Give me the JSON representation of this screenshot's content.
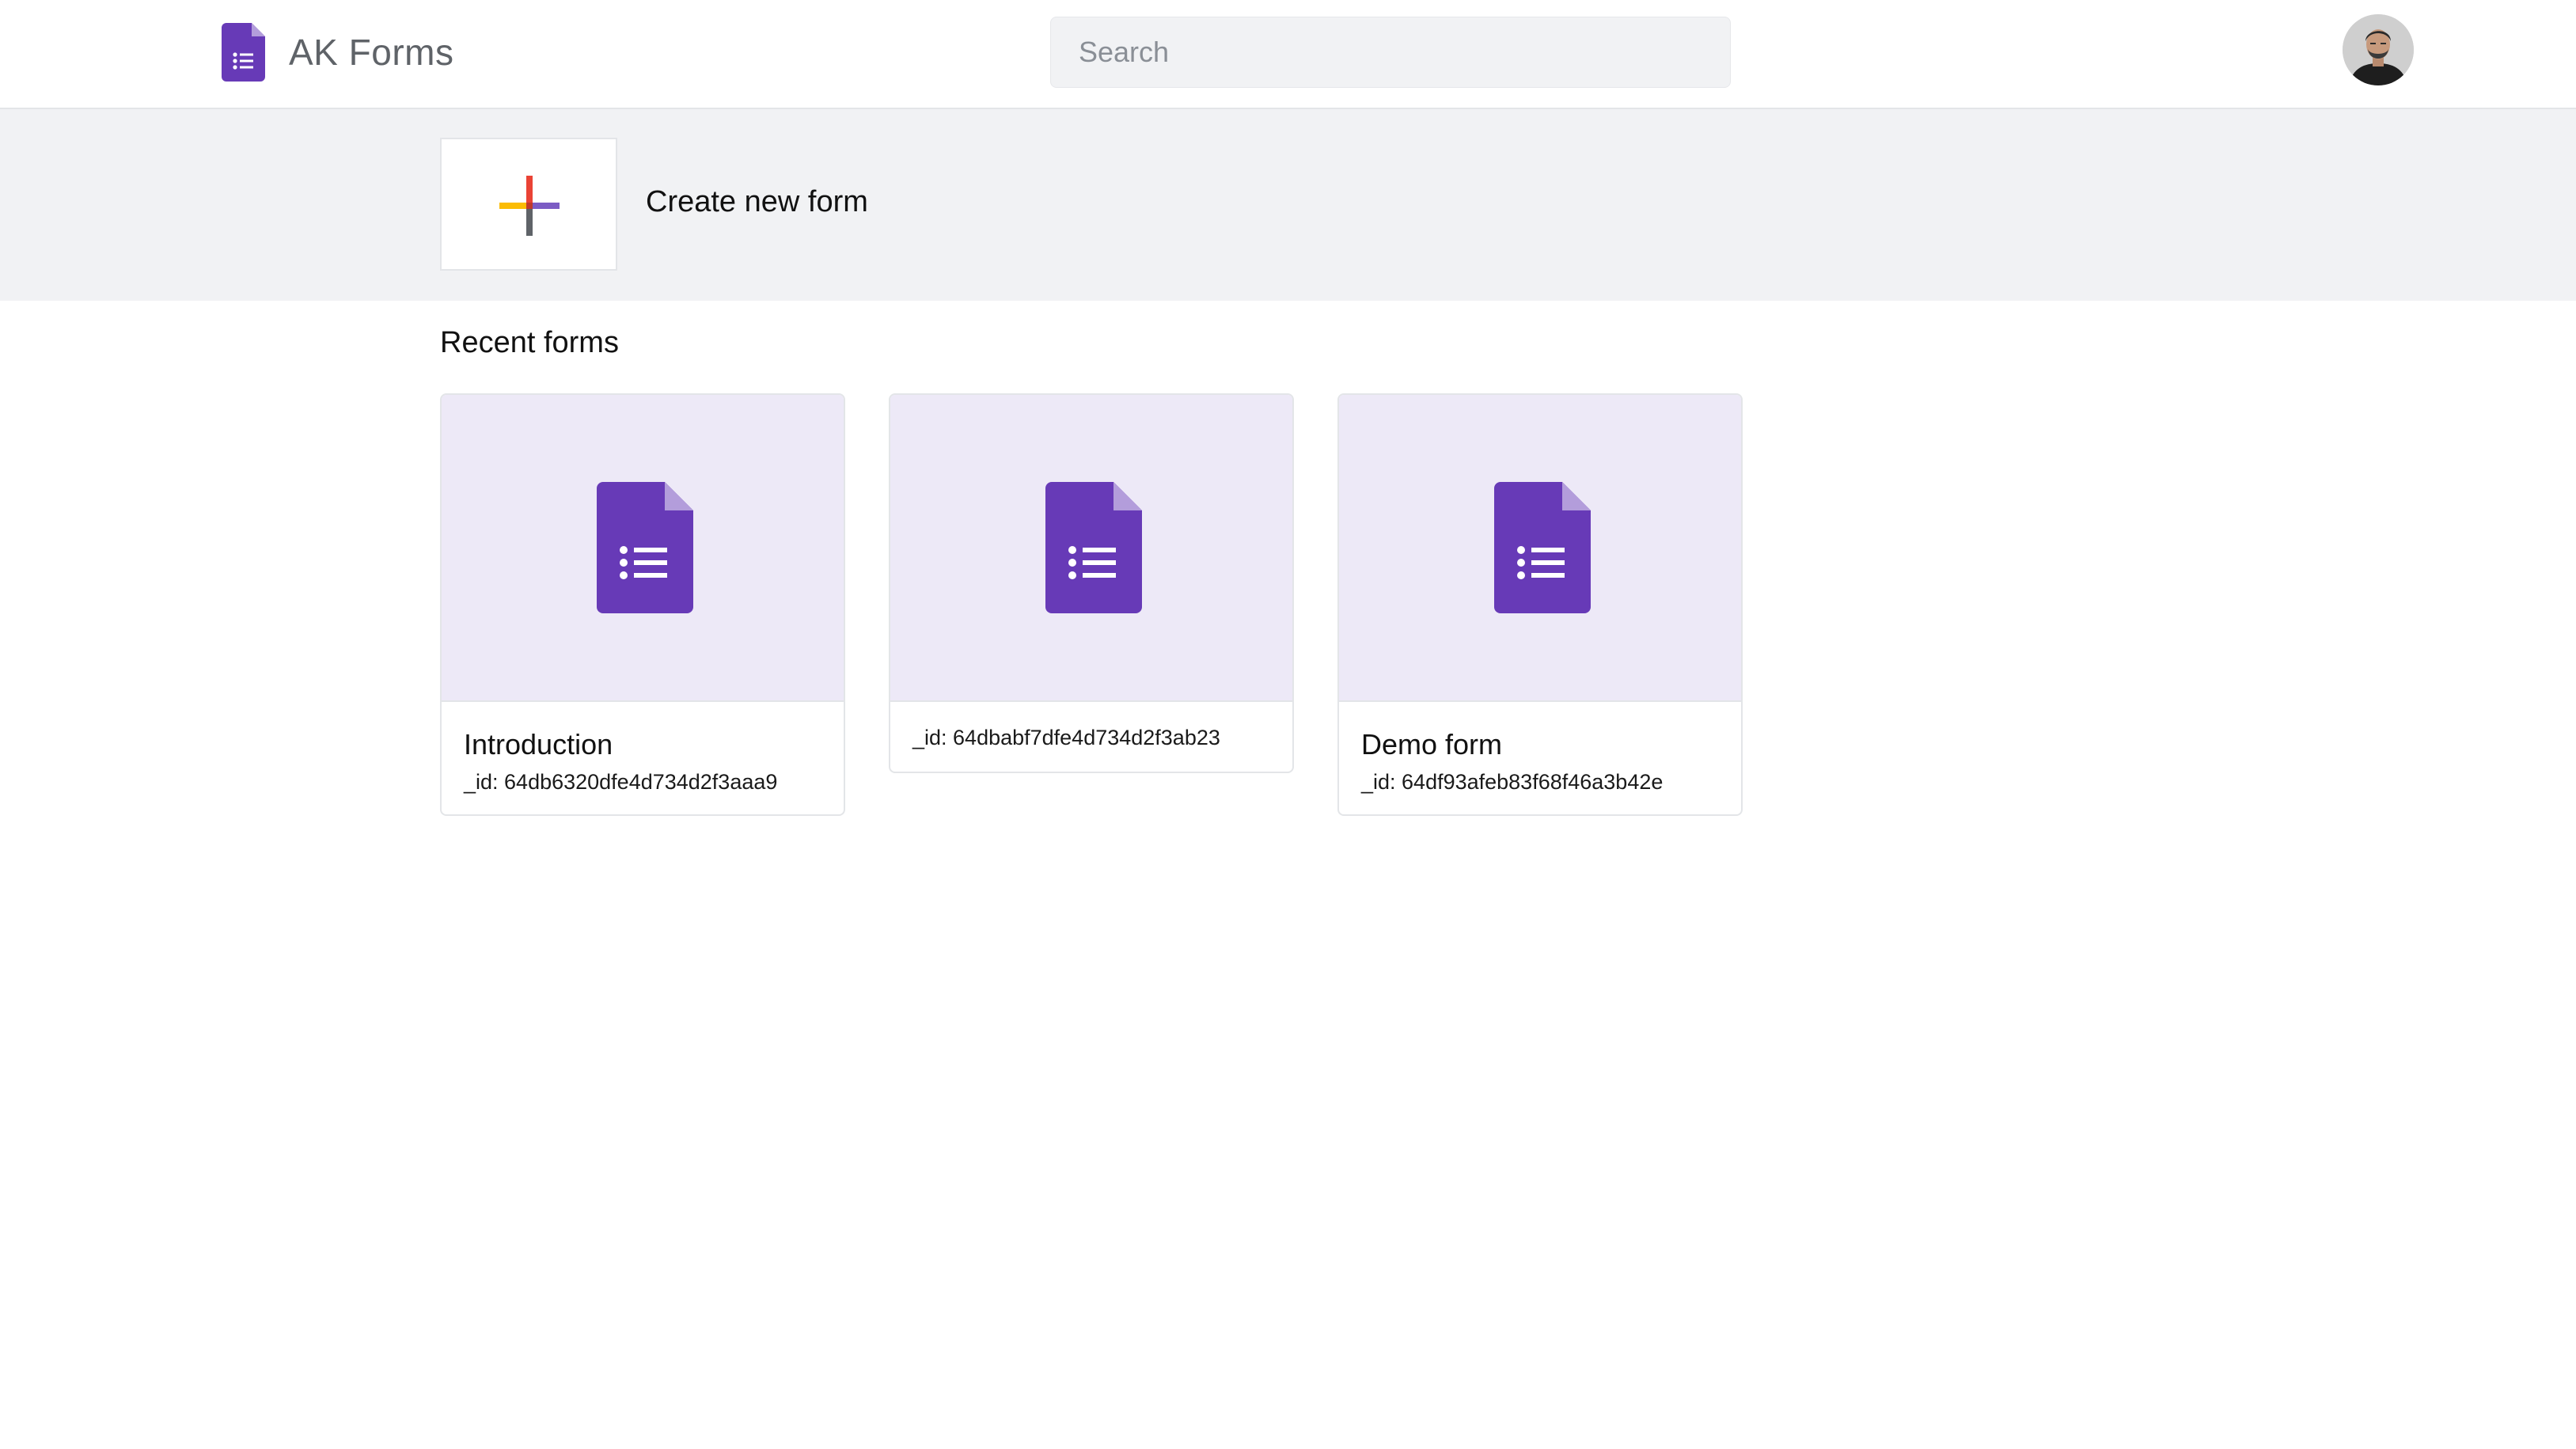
{
  "header": {
    "app_name": "AK Forms",
    "search": {
      "placeholder": "Search",
      "value": ""
    },
    "brand_icon": "forms-doc-icon",
    "avatar_icon": "user-avatar"
  },
  "create": {
    "label": "Create new form",
    "icon": "multicolor-plus-icon",
    "plus_colors": {
      "top": "#ea4335",
      "right": "#7c5cc4",
      "bottom": "#5f6368",
      "left": "#fbbc04"
    }
  },
  "recent": {
    "title": "Recent forms",
    "forms": [
      {
        "title": "Introduction",
        "id_text": "_id: 64db6320dfe4d734d2f3aaa9"
      },
      {
        "title": "",
        "id_text": "_id: 64dbabf7dfe4d734d2f3ab23"
      },
      {
        "title": "Demo form",
        "id_text": "_id: 64df93afeb83f68f46a3b42e"
      }
    ]
  },
  "colors": {
    "brand_purple": "#673ab7",
    "thumb_background": "#ede9f7",
    "band_background": "#f1f2f4"
  }
}
